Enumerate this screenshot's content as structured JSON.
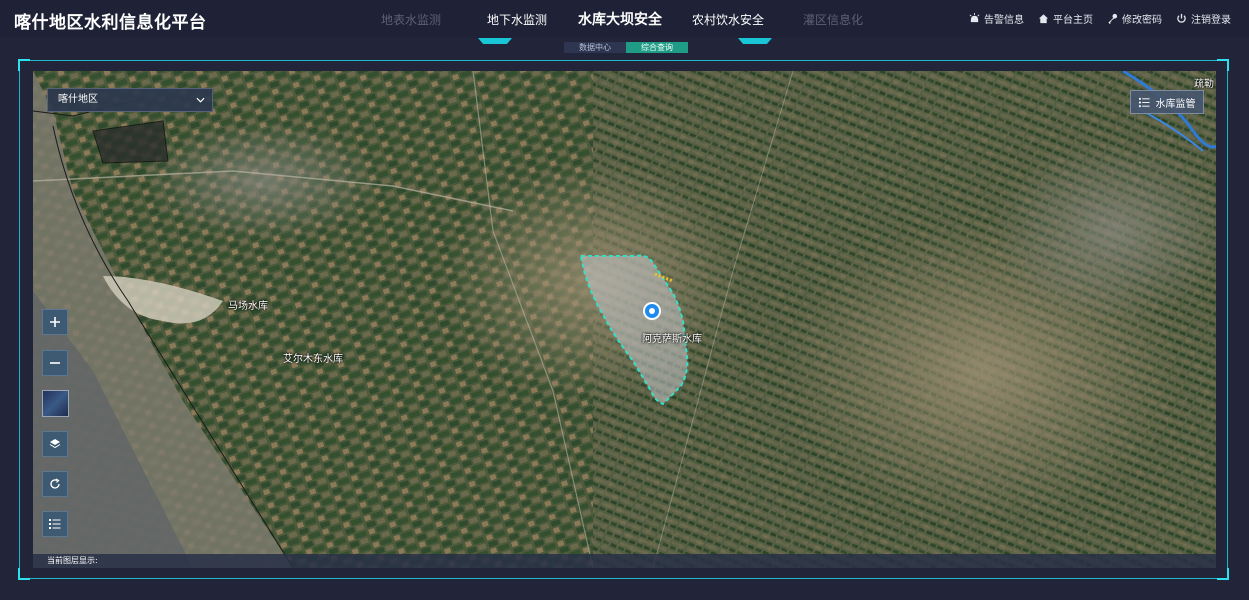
{
  "app": {
    "title": "喀什地区水利信息化平台"
  },
  "nav": {
    "tabs": [
      {
        "label": "地表水监测",
        "state": "disabled"
      },
      {
        "label": "地下水监测",
        "state": "enabled"
      },
      {
        "label": "水库大坝安全",
        "state": "active"
      },
      {
        "label": "农村饮水安全",
        "state": "enabled"
      },
      {
        "label": "灌区信息化",
        "state": "disabled"
      }
    ]
  },
  "actions": {
    "alerts": "告警信息",
    "home": "平台主页",
    "password": "修改密码",
    "logout": "注销登录"
  },
  "subtabs": [
    {
      "label": "数据中心",
      "active": false
    },
    {
      "label": "综合查询",
      "active": true
    }
  ],
  "map": {
    "region_select": {
      "value": "喀什地区"
    },
    "monitor_button": "水库监管",
    "corner_label": "疏勒",
    "labels": {
      "reservoir_main": "阿克萨斯水库",
      "reservoir_machang": "马场水库",
      "reservoir_aierm": "艾尔木东水库"
    },
    "status_prefix": "当前图层显示:"
  },
  "colors": {
    "accent": "#19c6d6",
    "boundary": "#35e0c8",
    "marker": "#1e8bf0"
  },
  "icons": {
    "zoom_in": "plus-icon",
    "zoom_out": "minus-icon",
    "layers": "layers-icon",
    "refresh": "refresh-icon",
    "legend": "list-icon"
  }
}
